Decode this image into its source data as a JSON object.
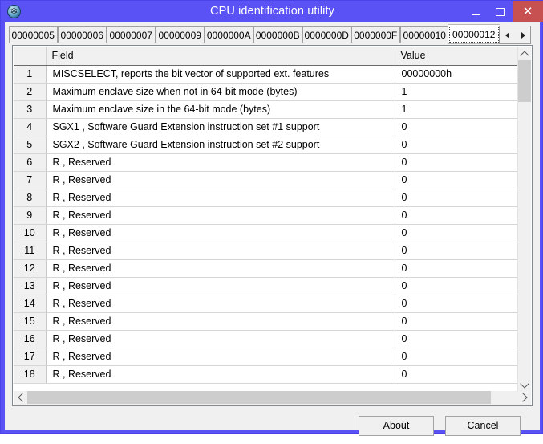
{
  "window": {
    "title": "CPU identification utility",
    "icon": "paw-app-icon",
    "accent_color": "#5a52f4",
    "close_color": "#c75050",
    "controls": {
      "minimize": "–",
      "maximize": "☐",
      "close": "✕"
    }
  },
  "tabs": {
    "items": [
      {
        "label": "00000005",
        "selected": false
      },
      {
        "label": "00000006",
        "selected": false
      },
      {
        "label": "00000007",
        "selected": false
      },
      {
        "label": "00000009",
        "selected": false
      },
      {
        "label": "0000000A",
        "selected": false
      },
      {
        "label": "0000000B",
        "selected": false
      },
      {
        "label": "0000000D",
        "selected": false
      },
      {
        "label": "0000000F",
        "selected": false
      },
      {
        "label": "00000010",
        "selected": false
      },
      {
        "label": "00000012",
        "selected": true
      }
    ],
    "scroll_prev": "◄",
    "scroll_next": "►"
  },
  "grid": {
    "headers": {
      "num": "",
      "field": "Field",
      "value": "Value"
    },
    "rows": [
      {
        "num": "1",
        "field": "MISCSELECT, reports the bit vector of supported ext. features",
        "value": "00000000h"
      },
      {
        "num": "2",
        "field": "Maximum enclave size when not in 64-bit mode (bytes)",
        "value": "1"
      },
      {
        "num": "3",
        "field": "Maximum enclave size in the 64-bit mode (bytes)",
        "value": "1"
      },
      {
        "num": "4",
        "field": "SGX1 , Software Guard Extension instruction set #1 support",
        "value": "0"
      },
      {
        "num": "5",
        "field": "SGX2 , Software Guard Extension instruction set #2 support",
        "value": "0"
      },
      {
        "num": "6",
        "field": "R , Reserved",
        "value": "0"
      },
      {
        "num": "7",
        "field": "R , Reserved",
        "value": "0"
      },
      {
        "num": "8",
        "field": "R , Reserved",
        "value": "0"
      },
      {
        "num": "9",
        "field": "R , Reserved",
        "value": "0"
      },
      {
        "num": "10",
        "field": "R , Reserved",
        "value": "0"
      },
      {
        "num": "11",
        "field": "R , Reserved",
        "value": "0"
      },
      {
        "num": "12",
        "field": "R , Reserved",
        "value": "0"
      },
      {
        "num": "13",
        "field": "R , Reserved",
        "value": "0"
      },
      {
        "num": "14",
        "field": "R , Reserved",
        "value": "0"
      },
      {
        "num": "15",
        "field": "R , Reserved",
        "value": "0"
      },
      {
        "num": "16",
        "field": "R , Reserved",
        "value": "0"
      },
      {
        "num": "17",
        "field": "R , Reserved",
        "value": "0"
      },
      {
        "num": "18",
        "field": "R , Reserved",
        "value": "0"
      }
    ]
  },
  "scrollbars": {
    "vertical": {
      "up": "∧",
      "down": "∨"
    },
    "horizontal": {
      "left": "‹",
      "right": "›"
    }
  },
  "buttons": {
    "about": "About",
    "cancel": "Cancel"
  }
}
